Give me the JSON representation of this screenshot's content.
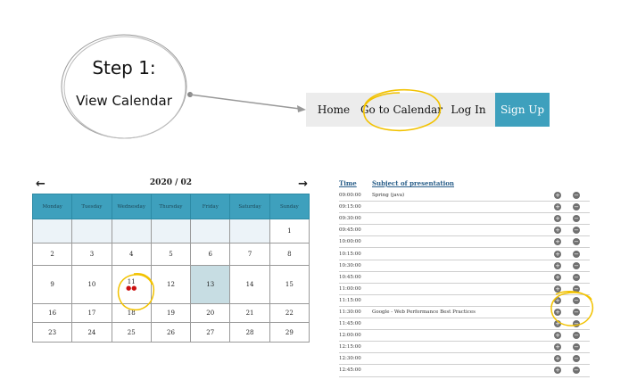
{
  "step": {
    "title": "Step 1:",
    "subtitle": "View Calendar"
  },
  "nav": {
    "home": "Home",
    "calendar": "Go to Calendar",
    "login": "Log In",
    "signup": "Sign Up"
  },
  "colors": {
    "accent": "#3ea0bd",
    "highlight": "#f2c200",
    "event_dot": "#cc1010"
  },
  "calendar": {
    "month_label": "2020 / 02",
    "prev": "←",
    "next": "→",
    "weekdays": [
      "Monday",
      "Tuesday",
      "Wednesday",
      "Thursday",
      "Friday",
      "Saturday",
      "Sunday"
    ],
    "weeks": [
      [
        "",
        "",
        "",
        "",
        "",
        "",
        "1"
      ],
      [
        "2",
        "3",
        "4",
        "5",
        "6",
        "7",
        "8"
      ],
      [
        "9",
        "10",
        "11",
        "12",
        "13",
        "14",
        "15"
      ],
      [
        "16",
        "17",
        "18",
        "19",
        "20",
        "21",
        "22"
      ],
      [
        "23",
        "24",
        "25",
        "26",
        "27",
        "28",
        "29"
      ]
    ],
    "event_dots": "●●"
  },
  "schedule": {
    "headers": {
      "time": "Time",
      "subject": "Subject of presentation"
    },
    "add_icon": "+",
    "remove_icon": "−",
    "rows": [
      {
        "time": "09:00:00",
        "subject": "Spring (java)"
      },
      {
        "time": "09:15:00",
        "subject": ""
      },
      {
        "time": "09:30:00",
        "subject": ""
      },
      {
        "time": "09:45:00",
        "subject": ""
      },
      {
        "time": "10:00:00",
        "subject": ""
      },
      {
        "time": "10:15:00",
        "subject": ""
      },
      {
        "time": "10:30:00",
        "subject": ""
      },
      {
        "time": "10:45:00",
        "subject": ""
      },
      {
        "time": "11:00:00",
        "subject": ""
      },
      {
        "time": "11:15:00",
        "subject": ""
      },
      {
        "time": "11:30:00",
        "subject": "Google - Web Performance Best Practices"
      },
      {
        "time": "11:45:00",
        "subject": ""
      },
      {
        "time": "12:00:00",
        "subject": ""
      },
      {
        "time": "12:15:00",
        "subject": ""
      },
      {
        "time": "12:30:00",
        "subject": ""
      },
      {
        "time": "12:45:00",
        "subject": ""
      }
    ]
  }
}
